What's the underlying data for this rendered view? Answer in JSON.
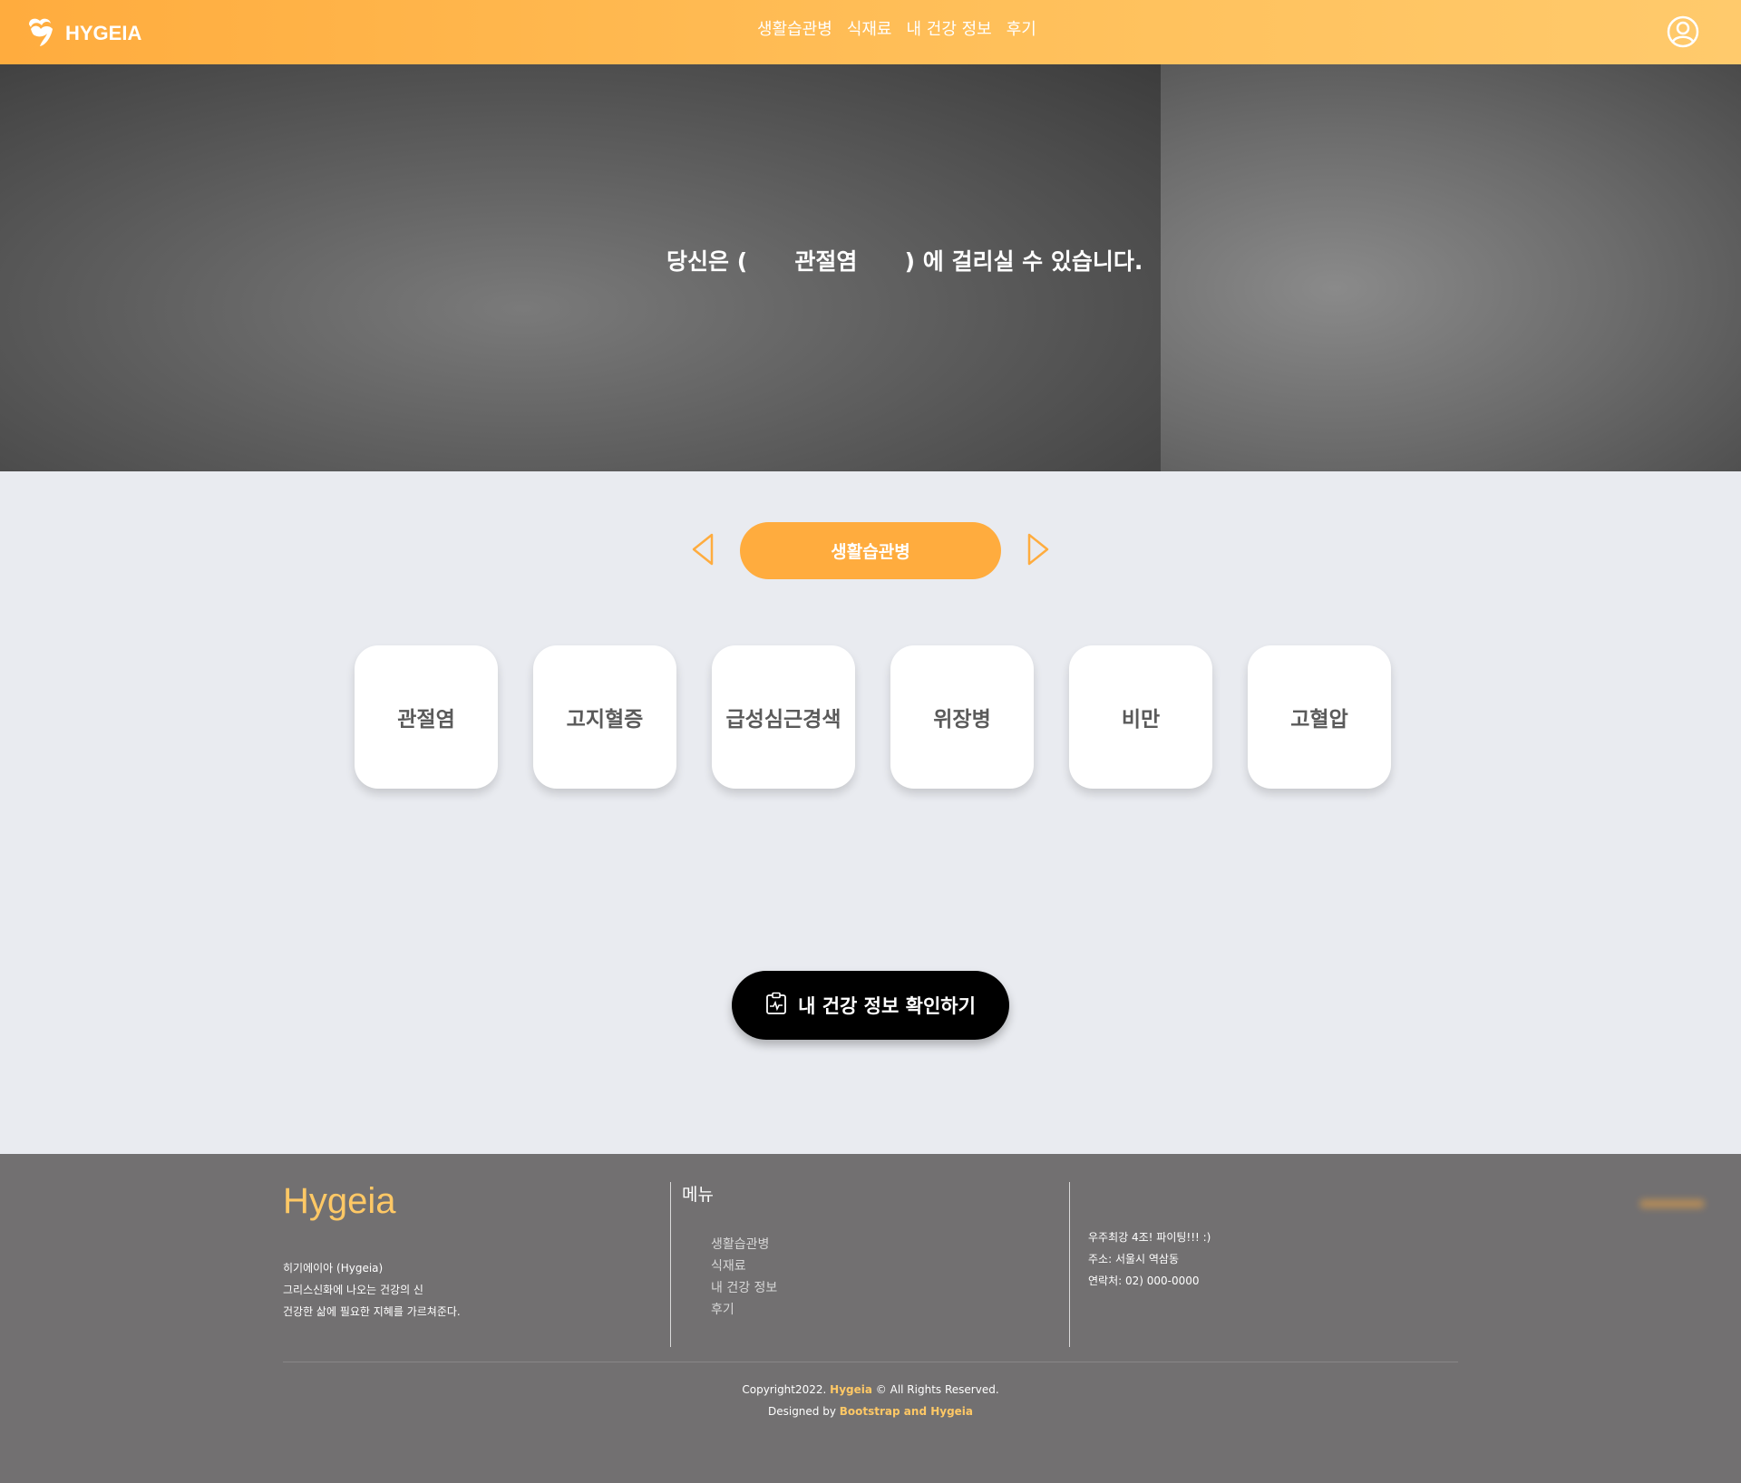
{
  "header": {
    "logo_text": "HYGEIA",
    "nav": [
      "생활습관병",
      "식재료",
      "내 건강 정보",
      "후기"
    ]
  },
  "hero": {
    "prefix": "당신은 (",
    "disease": "관절염",
    "suffix": ") 에 걸리실 수 있습니다."
  },
  "category": {
    "label": "생활습관병"
  },
  "cards": [
    "관절염",
    "고지혈증",
    "급성심근경색",
    "위장병",
    "비만",
    "고혈압"
  ],
  "check_button": {
    "label": "내 건강 정보 확인하기"
  },
  "footer": {
    "brand": "Hygeia",
    "desc": [
      "히기에이아 (Hygeia)",
      "그리스신화에 나오는 건강의 신",
      "건강한 삶에 필요한 지혜를 가르쳐준다."
    ],
    "menu_title": "메뉴",
    "menu": [
      "생활습관병",
      "식재료",
      "내 건강 정보",
      "후기"
    ],
    "contact": [
      "우주최강 4조! 파이팅!!! :)",
      "주소: 서울시 역삼동",
      "연락처: 02) 000-0000"
    ],
    "copyright_prefix": "Copyright2022. ",
    "copyright_brand": "Hygeia",
    "copyright_suffix": " © All Rights Reserved.",
    "designed_prefix": "Designed by ",
    "designed_brand": "Bootstrap and Hygeia"
  },
  "colors": {
    "accent": "#ffac3e",
    "footer_bg": "#727071",
    "page_bg": "#e9ebf0"
  },
  "icons": {
    "logo": "hygeia-logo-icon",
    "user": "user-circle-icon",
    "prev": "triangle-left-icon",
    "next": "triangle-right-icon",
    "health": "health-record-icon"
  }
}
